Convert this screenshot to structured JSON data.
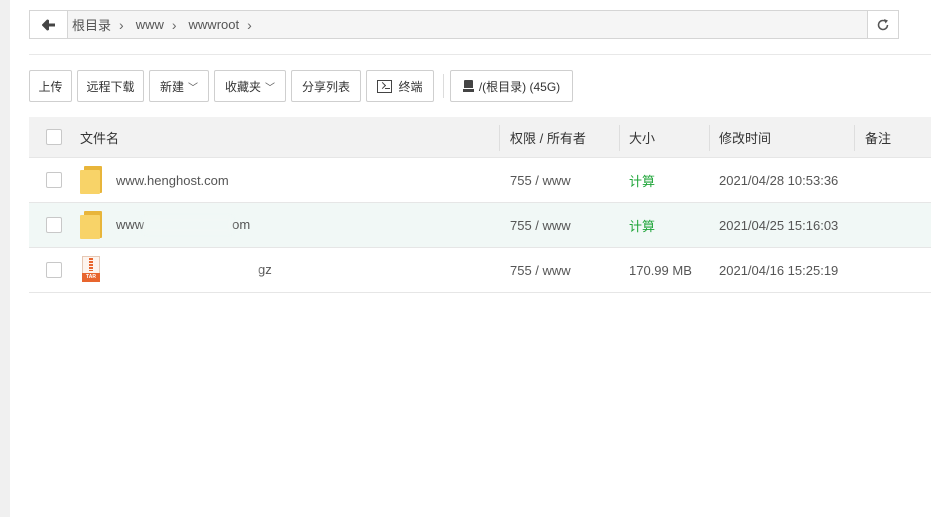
{
  "path": {
    "crumbs": [
      {
        "label": "根目录"
      },
      {
        "label": "www"
      },
      {
        "label": "wwwroot"
      }
    ]
  },
  "toolbar": {
    "upload": "上传",
    "remote_download": "远程下载",
    "new": "新建",
    "favorites": "收藏夹",
    "share_list": "分享列表",
    "terminal": "终端",
    "disk": "/(根目录) (45G)"
  },
  "table": {
    "headers": {
      "name": "文件名",
      "perm": "权限 / 所有者",
      "size": "大小",
      "mtime": "修改时间",
      "note": "备注"
    },
    "rows": [
      {
        "type": "folder",
        "name": "www.henghost.com",
        "perm": "755 / www",
        "size": "计算",
        "mtime": "2021/04/28 10:53:36"
      },
      {
        "type": "folder",
        "name_prefix": "www",
        "name_suffix": "om",
        "perm": "755 / www",
        "size": "计算",
        "mtime": "2021/04/25 15:16:03"
      },
      {
        "type": "archive",
        "name_prefix": "",
        "name_suffix": "gz",
        "icon_text": "TAR",
        "perm": "755 / www",
        "size": "170.99 MB",
        "mtime": "2021/04/16 15:25:19"
      }
    ]
  },
  "colors": {
    "accent_green": "#20a53a",
    "folder_yellow": "#f8d368",
    "archive_orange": "#e8652e"
  }
}
